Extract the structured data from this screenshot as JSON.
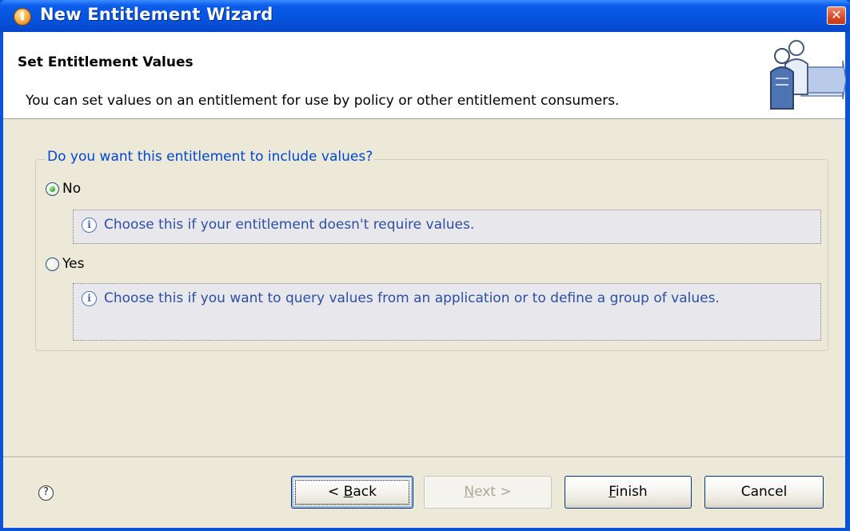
{
  "window": {
    "title": "New Entitlement Wizard",
    "close_label": "✕"
  },
  "banner": {
    "title": "Set Entitlement Values",
    "description": "You can set values on an entitlement for use by policy or other entitlement consumers."
  },
  "question_group": {
    "legend": "Do you want this entitlement to include values?",
    "options": [
      {
        "label": "No",
        "selected": true,
        "info": "Choose this if your entitlement doesn't require values."
      },
      {
        "label": "Yes",
        "selected": false,
        "info": "Choose this if you want to query values from an application or to define a group of values."
      }
    ]
  },
  "footer": {
    "help_symbol": "?",
    "info_symbol": "i",
    "back": {
      "prefix": "< ",
      "mnemonic": "B",
      "rest": "ack",
      "enabled": true,
      "focused": true
    },
    "next": {
      "mnemonic": "N",
      "rest": "ext >",
      "enabled": false
    },
    "finish": {
      "mnemonic": "F",
      "rest": "inish",
      "enabled": true
    },
    "cancel": {
      "label": "Cancel",
      "enabled": true
    }
  },
  "colors": {
    "titlebar": "#0553df",
    "dialog_bg": "#ece9d8",
    "legend_text": "#0046d5",
    "info_text": "#2c4fa0",
    "radio_checked": "#2fa52a"
  },
  "icons": [
    "app-icon",
    "close-icon",
    "wizard-users-graphic",
    "info-icon",
    "help-icon"
  ]
}
